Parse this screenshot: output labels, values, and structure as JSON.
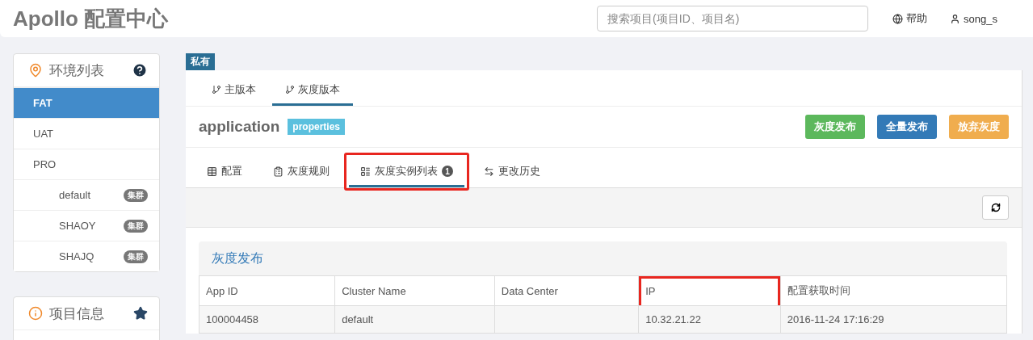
{
  "header": {
    "logo": "Apollo 配置中心",
    "search": {
      "placeholder": "搜索项目(项目ID、项目名)"
    },
    "links": [
      {
        "kind": "help",
        "label": "帮助"
      },
      {
        "kind": "user",
        "label": "song_s"
      }
    ]
  },
  "sidebar": {
    "env_panel": {
      "title": "环境列表",
      "items": [
        {
          "label": "FAT",
          "selected": true
        },
        {
          "label": "UAT",
          "selected": false
        },
        {
          "label": "PRO",
          "selected": false,
          "children": [
            {
              "label": "default",
              "badge": "集群",
              "selected": false
            },
            {
              "label": "SHAOY",
              "badge": "集群",
              "selected": false
            },
            {
              "label": "SHAJQ",
              "badge": "集群",
              "selected": false
            }
          ]
        }
      ]
    },
    "project_panel": {
      "title": "项目信息"
    }
  },
  "namespace": {
    "scope_tag": "私有",
    "branch_tabs": [
      {
        "label": "主版本",
        "selected": false
      },
      {
        "label": "灰度版本",
        "selected": true
      }
    ],
    "name": "application",
    "format": "properties",
    "actions": [
      {
        "label": "灰度发布",
        "color": "#5cb85c"
      },
      {
        "label": "全量发布",
        "color": "#337ab7"
      },
      {
        "label": "放弃灰度",
        "color": "#f0ad4e"
      }
    ],
    "tabs": [
      {
        "kind": "table",
        "label": "配置",
        "selected": false,
        "highlighted": false
      },
      {
        "kind": "rules",
        "label": "灰度规则",
        "selected": false,
        "highlighted": false
      },
      {
        "kind": "instances",
        "label": "灰度实例列表",
        "count": "1",
        "selected": true,
        "highlighted": true
      },
      {
        "kind": "history",
        "label": "更改历史",
        "selected": false,
        "highlighted": false
      }
    ],
    "instances": {
      "title": "灰度发布",
      "columns": [
        {
          "label": "App ID",
          "highlighted": false
        },
        {
          "label": "Cluster Name",
          "highlighted": false
        },
        {
          "label": "Data Center",
          "highlighted": false
        },
        {
          "label": "IP",
          "highlighted": true
        },
        {
          "label": "配置获取时间",
          "highlighted": false
        }
      ],
      "rows": [
        {
          "cells": [
            "100004458",
            "default",
            null,
            "10.32.21.22",
            "2016-11-24 17:16:29"
          ]
        }
      ]
    }
  }
}
